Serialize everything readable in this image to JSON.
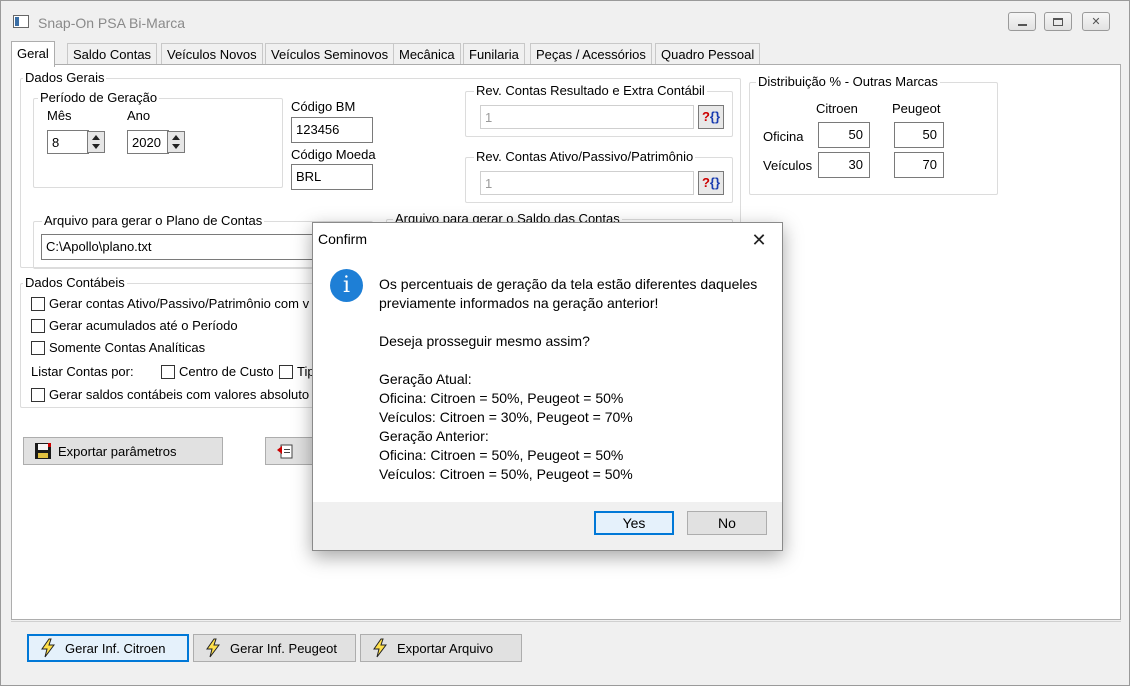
{
  "window": {
    "title": "Snap-On PSA Bi-Marca",
    "controls": [
      "minimize",
      "maximize",
      "close"
    ]
  },
  "tabs": [
    {
      "label": "Geral",
      "active": true
    },
    {
      "label": "Saldo Contas"
    },
    {
      "label": "Veículos Novos"
    },
    {
      "label": "Veículos Seminovos"
    },
    {
      "label": "Mecânica"
    },
    {
      "label": "Funilaria"
    },
    {
      "label": "Peças / Acessórios"
    },
    {
      "label": "Quadro Pessoal"
    }
  ],
  "dados_gerais": {
    "title": "Dados Gerais",
    "periodo": {
      "title": "Período de Geração",
      "mes_label": "Mês",
      "mes_value": "8",
      "ano_label": "Ano",
      "ano_value": "2020"
    },
    "codigo_bm_label": "Código BM",
    "codigo_bm_value": "123456",
    "codigo_moeda_label": "Código Moeda",
    "codigo_moeda_value": "BRL",
    "rev_resultado": {
      "title": "Rev. Contas Resultado e Extra Contábil",
      "value": "1"
    },
    "rev_ativo": {
      "title": "Rev. Contas Ativo/Passivo/Patrimônio",
      "value": "1"
    },
    "arquivo_plano": {
      "title": "Arquivo para gerar o Plano de Contas",
      "value": "C:\\Apollo\\plano.txt"
    },
    "arquivo_saldo": {
      "title": "Arquivo para gerar o Saldo das Contas"
    }
  },
  "distribuicao": {
    "title": "Distribuição % - Outras Marcas",
    "col_citroen": "Citroen",
    "col_peugeot": "Peugeot",
    "row_oficina": "Oficina",
    "row_veiculos": "Veículos",
    "oficina_citroen": "50",
    "oficina_peugeot": "50",
    "veiculos_citroen": "30",
    "veiculos_peugeot": "70"
  },
  "dados_contabeis": {
    "title": "Dados Contábeis",
    "chk1": "Gerar contas Ativo/Passivo/Patrimônio com v",
    "chk2": "Gerar acumulados até o Período",
    "chk3": "Somente Contas Analíticas",
    "listar_label": "Listar Contas por:",
    "chk_centro": "Centro de Custo",
    "chk_tipo": "Tipo",
    "chk5": "Gerar saldos contábeis com valores absoluto"
  },
  "buttons": {
    "exportar_parametros": "Exportar parâmetros",
    "gerar_citroen": "Gerar Inf. Citroen",
    "gerar_peugeot": "Gerar Inf. Peugeot",
    "exportar_arquivo": "Exportar Arquivo"
  },
  "dialog": {
    "title": "Confirm",
    "icon": "info-icon",
    "lines": [
      "Os percentuais de geração da tela estão diferentes daqueles",
      "previamente informados na geração anterior!",
      "",
      "Deseja prosseguir mesmo assim?",
      "",
      "Geração Atual:",
      "Oficina: Citroen = 50%, Peugeot = 50%",
      "Veículos: Citroen = 30%, Peugeot = 70%",
      "Geração Anterior:",
      "Oficina: Citroen = 50%, Peugeot = 50%",
      "Veículos: Citroen = 50%, Peugeot = 50%"
    ],
    "yes": "Yes",
    "no": "No"
  },
  "colors": {
    "info_icon": "#1e7fd6",
    "default_button_border": "#0078d7"
  }
}
